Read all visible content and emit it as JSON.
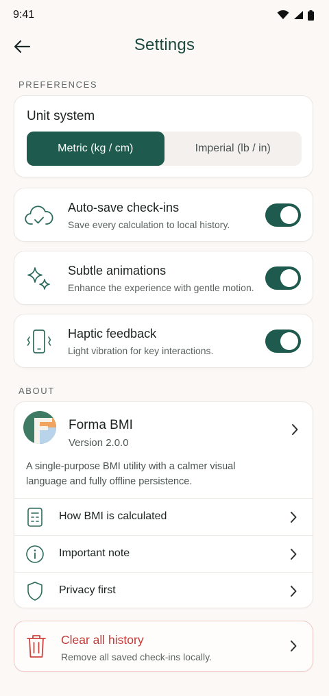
{
  "status_bar": {
    "time": "9:41"
  },
  "header": {
    "title": "Settings"
  },
  "preferences": {
    "section_label": "PREFERENCES",
    "unit_system": {
      "title": "Unit system",
      "options": [
        "Metric (kg / cm)",
        "Imperial (lb / in)"
      ],
      "selected": "Metric (kg / cm)"
    },
    "toggles": [
      {
        "title": "Auto-save check-ins",
        "subtitle": "Save every calculation to local history.",
        "enabled": true,
        "icon": "cloud-check-icon"
      },
      {
        "title": "Subtle animations",
        "subtitle": "Enhance the experience with gentle motion.",
        "enabled": true,
        "icon": "sparkles-icon"
      },
      {
        "title": "Haptic feedback",
        "subtitle": "Light vibration for key interactions.",
        "enabled": true,
        "icon": "phone-vibrate-icon"
      }
    ]
  },
  "about": {
    "section_label": "ABOUT",
    "app_name": "Forma BMI",
    "version": "Version 2.0.0",
    "description": "A single-purpose BMI utility with a calmer visual language and fully offline persistence.",
    "rows": [
      {
        "label": "How BMI is calculated",
        "icon": "calculator-icon"
      },
      {
        "label": "Important note",
        "icon": "info-icon"
      },
      {
        "label": "Privacy first",
        "icon": "shield-icon"
      }
    ]
  },
  "danger": {
    "title": "Clear all history",
    "subtitle": "Remove all saved check-ins locally."
  },
  "colors": {
    "accent": "#1e5a4d",
    "title": "#1c4a40",
    "danger": "#c33a36",
    "background": "#fbf8f6"
  }
}
